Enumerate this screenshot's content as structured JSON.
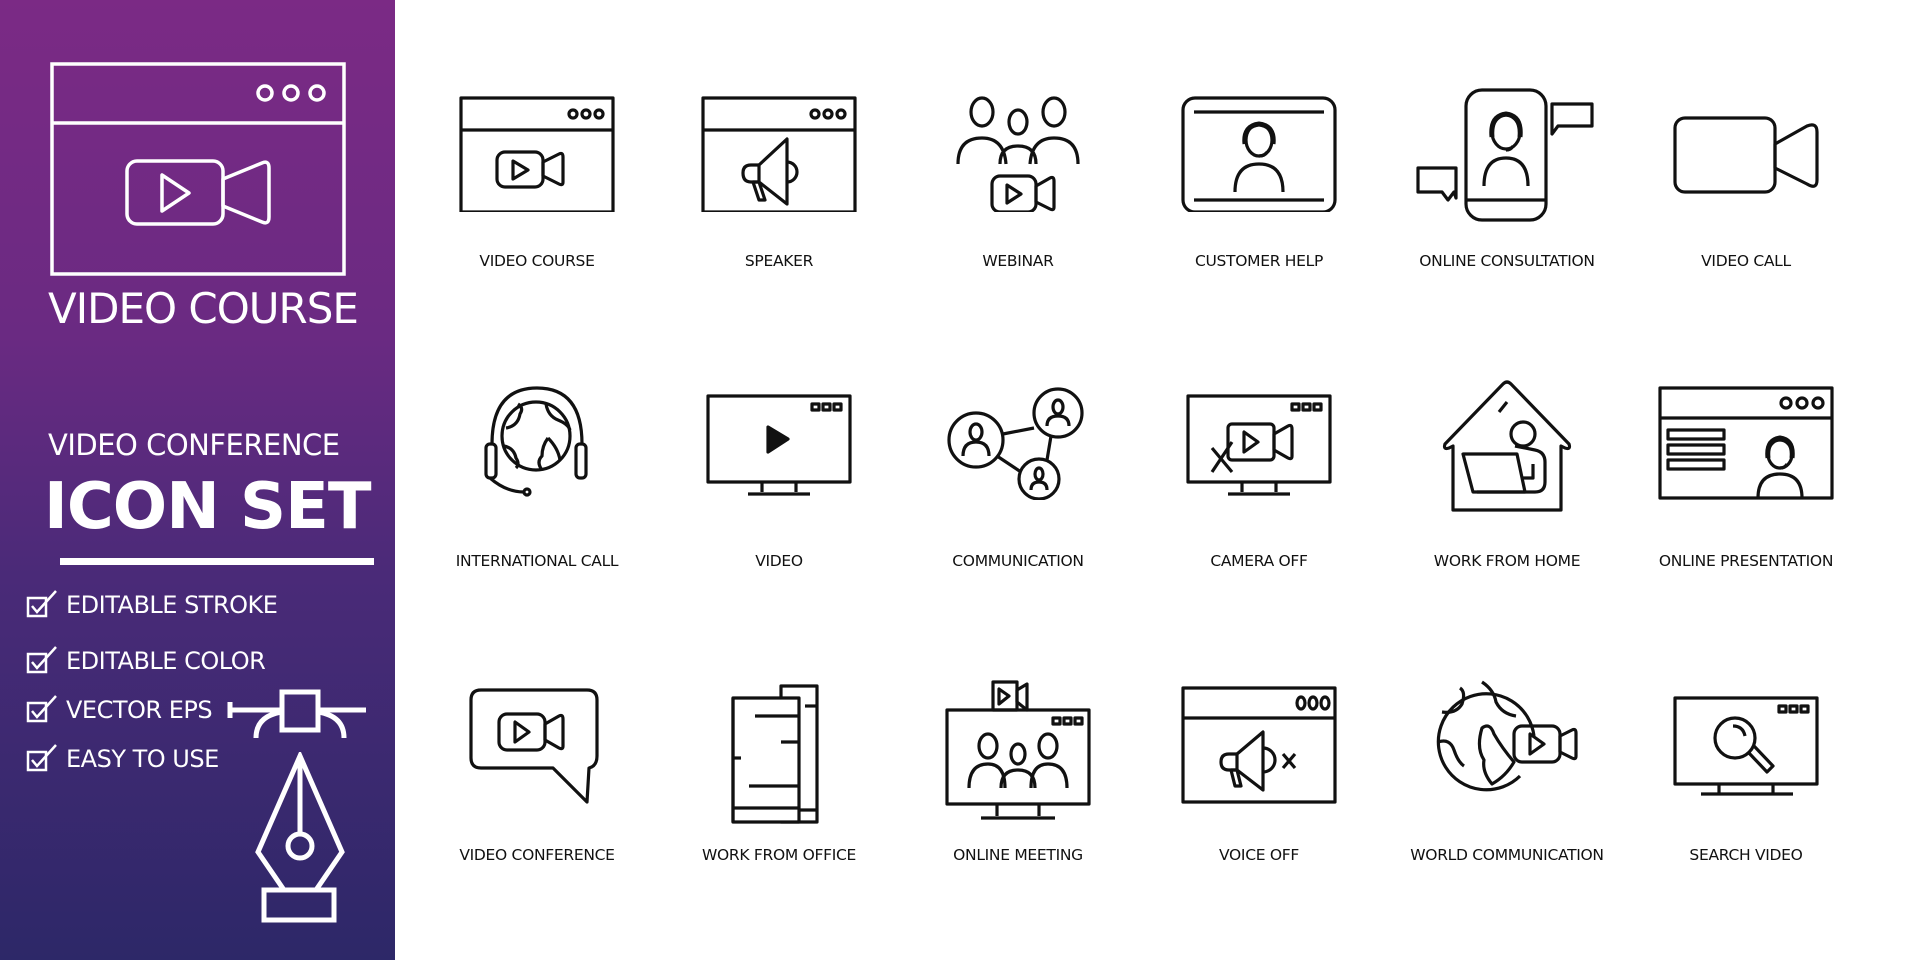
{
  "sidebar": {
    "hero_icon": "video-course-window-icon",
    "hero_title": "VIDEO COURSE",
    "subtitle": "VIDEO CONFERENCE",
    "title": "ICON SET",
    "features": [
      {
        "label": "EDITABLE STROKE",
        "icon": "checkbox-checked-icon"
      },
      {
        "label": "EDITABLE COLOR",
        "icon": "checkbox-checked-icon"
      },
      {
        "label": "VECTOR EPS",
        "icon": "checkbox-checked-icon"
      },
      {
        "label": "EASY TO USE",
        "icon": "checkbox-checked-icon"
      }
    ],
    "decor_icons": [
      "bezier-anchor-icon",
      "pen-nib-icon"
    ],
    "colors": {
      "gradient_top": "#7b2a85",
      "gradient_bottom": "#2d2868",
      "text": "#ffffff"
    }
  },
  "icons": [
    {
      "label": "VIDEO COURSE",
      "icon": "video-course-icon"
    },
    {
      "label": "SPEAKER",
      "icon": "speaker-icon"
    },
    {
      "label": "WEBINAR",
      "icon": "webinar-icon"
    },
    {
      "label": "CUSTOMER HELP",
      "icon": "customer-help-icon"
    },
    {
      "label": "ONLINE CONSULTATION",
      "icon": "online-consultation-icon"
    },
    {
      "label": "VIDEO CALL",
      "icon": "video-call-icon"
    },
    {
      "label": "INTERNATIONAL CALL",
      "icon": "international-call-icon"
    },
    {
      "label": "VIDEO",
      "icon": "video-icon"
    },
    {
      "label": "COMMUNICATION",
      "icon": "communication-icon"
    },
    {
      "label": "CAMERA OFF",
      "icon": "camera-off-icon"
    },
    {
      "label": "WORK FROM HOME",
      "icon": "work-from-home-icon"
    },
    {
      "label": "ONLINE PRESENTATION",
      "icon": "online-presentation-icon"
    },
    {
      "label": "VIDEO CONFERENCE",
      "icon": "video-conference-icon"
    },
    {
      "label": "WORK FROM OFFICE",
      "icon": "work-from-office-icon"
    },
    {
      "label": "ONLINE MEETING",
      "icon": "online-meeting-icon"
    },
    {
      "label": "VOICE OFF",
      "icon": "voice-off-icon"
    },
    {
      "label": "WORLD COMMUNICATION",
      "icon": "world-communication-icon"
    },
    {
      "label": "SEARCH VIDEO",
      "icon": "search-video-icon"
    }
  ],
  "colors": {
    "icon_stroke": "#111111",
    "background": "#ffffff"
  }
}
